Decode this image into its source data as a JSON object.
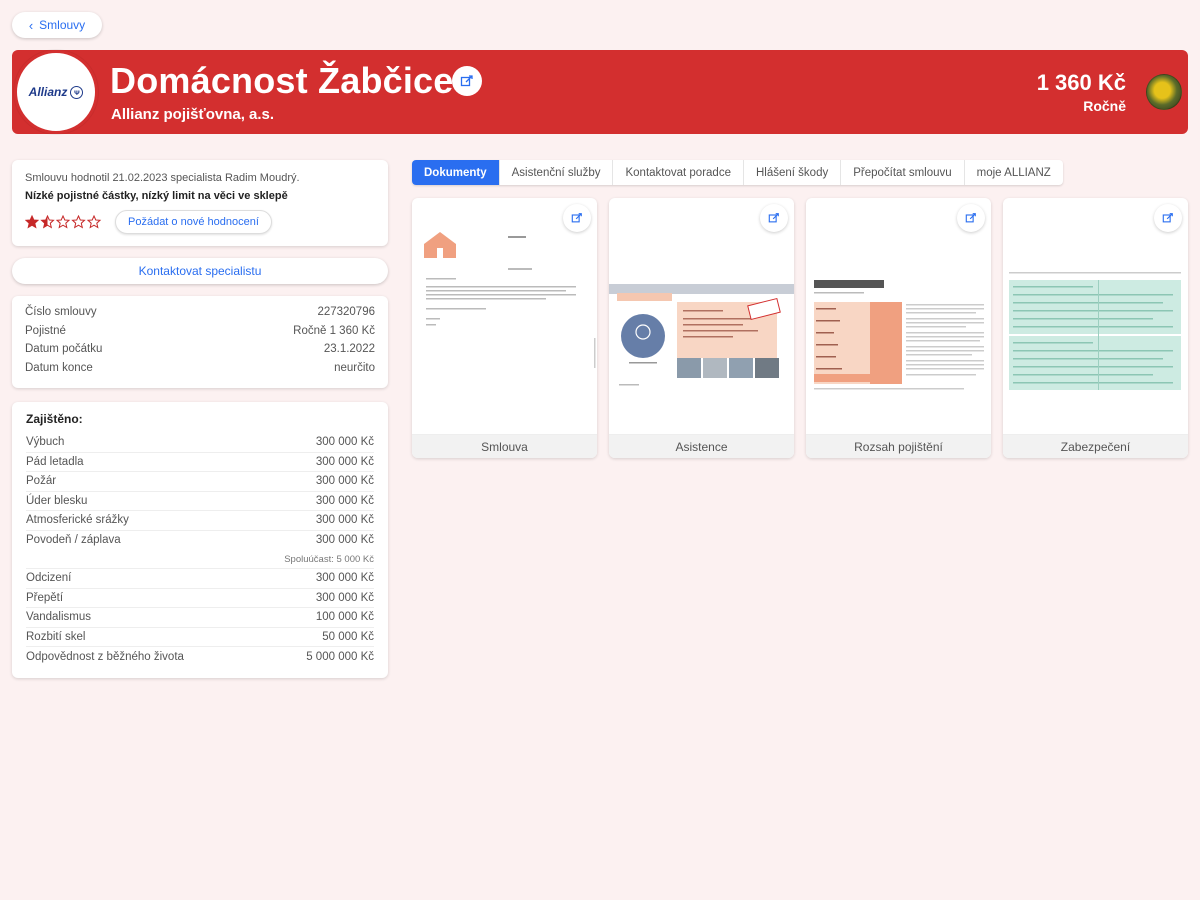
{
  "nav": {
    "back_label": "Smlouvy"
  },
  "header": {
    "logo_text": "Allianz",
    "title": "Domácnost Žabčice",
    "insurer": "Allianz pojišťovna, a.s.",
    "price": "1 360 Kč",
    "period": "Ročně",
    "accent_color": "#d32f2f"
  },
  "rating": {
    "text": "Smlouvu hodnotil 21.02.2023 specialista Radim Moudrý.",
    "summary": "Nízké pojistné částky, nízký limit na věci ve sklepě",
    "stars_filled": 1.5,
    "stars_total": 5,
    "request_label": "Požádat o nové hodnocení"
  },
  "contact": {
    "label": "Kontaktovat specialistu"
  },
  "info": [
    {
      "label": "Číslo smlouvy",
      "value": "227320796"
    },
    {
      "label": "Pojistné",
      "value": "Ročně 1 360 Kč"
    },
    {
      "label": "Datum počátku",
      "value": "23.1.2022"
    },
    {
      "label": "Datum konce",
      "value": "neurčito"
    }
  ],
  "coverage": {
    "title": "Zajištěno:",
    "items": [
      {
        "label": "Výbuch",
        "value": "300 000 Kč"
      },
      {
        "label": "Pád letadla",
        "value": "300 000 Kč"
      },
      {
        "label": "Požár",
        "value": "300 000 Kč"
      },
      {
        "label": "Úder blesku",
        "value": "300 000 Kč"
      },
      {
        "label": "Atmosferické srážky",
        "value": "300 000 Kč"
      },
      {
        "label": "Povodeň / záplava",
        "value": "300 000 Kč"
      }
    ],
    "note": "Spoluúčast: 5 000 Kč",
    "items2": [
      {
        "label": "Odcizení",
        "value": "300 000 Kč"
      },
      {
        "label": "Přepětí",
        "value": "300 000 Kč"
      },
      {
        "label": "Vandalismus",
        "value": "100 000 Kč"
      },
      {
        "label": "Rozbití skel",
        "value": "50 000 Kč"
      },
      {
        "label": "Odpovědnost z běžného života",
        "value": "5 000 000 Kč"
      }
    ]
  },
  "tabs": [
    {
      "label": "Dokumenty",
      "active": true
    },
    {
      "label": "Asistenční služby",
      "active": false
    },
    {
      "label": "Kontaktovat poradce",
      "active": false
    },
    {
      "label": "Hlášení škody",
      "active": false
    },
    {
      "label": "Přepočítat smlouvu",
      "active": false
    },
    {
      "label": "moje ALLIANZ",
      "active": false
    }
  ],
  "documents": [
    {
      "label": "Smlouva"
    },
    {
      "label": "Asistence"
    },
    {
      "label": "Rozsah pojištění"
    },
    {
      "label": "Zabezpečení"
    }
  ]
}
